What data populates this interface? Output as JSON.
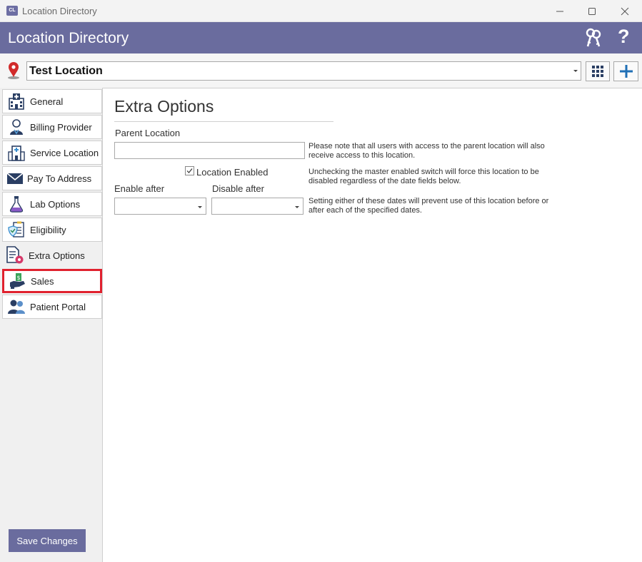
{
  "window": {
    "app_icon_text": "CL",
    "title": "Location Directory"
  },
  "header": {
    "title": "Location Directory",
    "help_label": "?"
  },
  "location": {
    "selected": "Test Location"
  },
  "sidebar": {
    "items": [
      {
        "label": "General",
        "icon": "hospital-icon"
      },
      {
        "label": "Billing Provider",
        "icon": "doctor-icon"
      },
      {
        "label": "Service Location",
        "icon": "building-icon"
      },
      {
        "label": "Pay To Address",
        "icon": "envelope-icon"
      },
      {
        "label": "Lab Options",
        "icon": "flask-icon"
      },
      {
        "label": "Eligibility",
        "icon": "shield-checklist-icon"
      },
      {
        "label": "Extra Options",
        "icon": "document-gear-icon"
      },
      {
        "label": "Sales",
        "icon": "money-hand-icon"
      },
      {
        "label": "Patient Portal",
        "icon": "users-icon"
      }
    ],
    "active": "Extra Options",
    "highlighted": "Sales",
    "save_label": "Save Changes"
  },
  "content": {
    "title": "Extra Options",
    "parent_location_label": "Parent Location",
    "parent_location_value": "",
    "parent_note": "Please note that all users with access to the parent location will also receive access to this location.",
    "location_enabled_label": "Location Enabled",
    "location_enabled_checked": true,
    "enabled_note": "Unchecking the master enabled switch will force this location to be disabled regardless of the date fields below.",
    "enable_after_label": "Enable after",
    "disable_after_label": "Disable after",
    "enable_after_value": "",
    "disable_after_value": "",
    "dates_note": "Setting either of these dates will prevent use of this location before or after each of the specified dates."
  },
  "colors": {
    "accent": "#6a6c9e",
    "highlight": "#e0212e",
    "add_blue": "#1f6fb5"
  }
}
